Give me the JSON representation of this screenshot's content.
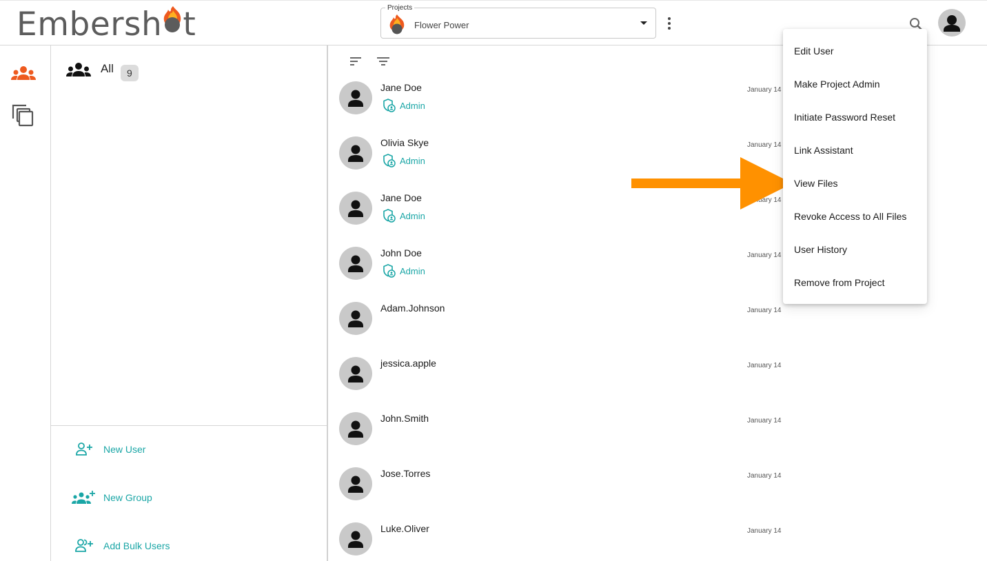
{
  "app": {
    "logo_text_before": "Embersh",
    "logo_text_after": "t"
  },
  "header": {
    "project_select": {
      "legend": "Projects",
      "selected": "Flower Power"
    }
  },
  "groups": {
    "all_label": "All",
    "all_count": "9",
    "actions": {
      "new_user": "New User",
      "new_group": "New Group",
      "add_bulk_users": "Add Bulk Users"
    }
  },
  "users": [
    {
      "name": "Jane Doe",
      "role": "Admin",
      "date": "January 14"
    },
    {
      "name": "Olivia Skye",
      "role": "Admin",
      "date": "January 14"
    },
    {
      "name": "Jane Doe",
      "role": "Admin",
      "date": "January 14"
    },
    {
      "name": "John Doe",
      "role": "Admin",
      "date": "January 14"
    },
    {
      "name": "Adam.Johnson",
      "role": "",
      "date": "January 14"
    },
    {
      "name": "jessica.apple",
      "role": "",
      "date": "January 14"
    },
    {
      "name": "John.Smith",
      "role": "",
      "date": "January 14"
    },
    {
      "name": "Jose.Torres",
      "role": "",
      "date": "January 14"
    },
    {
      "name": "Luke.Oliver",
      "role": "",
      "date": "January 14"
    }
  ],
  "context_menu": {
    "items": [
      "Edit User",
      "Make Project Admin",
      "Initiate Password Reset",
      "Link Assistant",
      "View Files",
      "Revoke Access to All Files",
      "User History",
      "Remove from Project"
    ],
    "highlighted": "View Files"
  },
  "colors": {
    "brand_orange": "#ee5a1f",
    "accent_teal": "#1aa6a6",
    "callout_orange": "#ff9100",
    "logo_gray": "#5c5c5c"
  },
  "icons": {
    "search": "search-icon",
    "account": "account-icon",
    "more": "more-vert-icon",
    "users_nav": "groups-icon",
    "files_nav": "library-icon",
    "sort": "sort-icon",
    "filter": "filter-icon",
    "admin": "admin-shield-icon"
  }
}
